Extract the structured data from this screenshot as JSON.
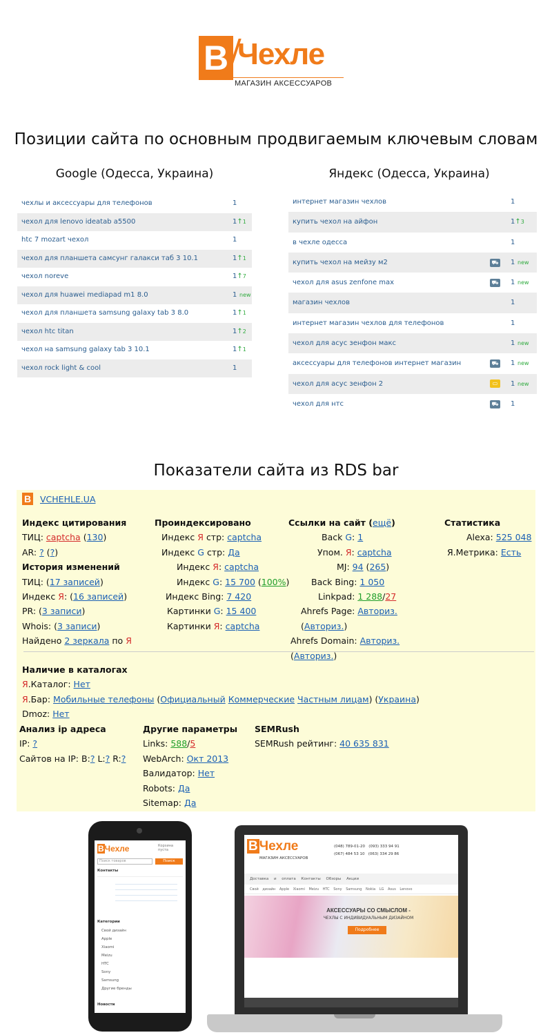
{
  "logo": {
    "letter": "B",
    "name": "Чехле",
    "subtitle": "МАГАЗИН АКСЕССУАРОВ",
    "brand_color": "#f07b1a"
  },
  "title_positions": "Позиции сайта по основным продвигаемым ключевым словам",
  "google": {
    "title": "Google (Одесса, Украина)",
    "rows": [
      {
        "kw": "чехлы и аксессуары для телефонов",
        "pos": "1",
        "arrow": "",
        "change": ""
      },
      {
        "kw": "чехол для lenovo ideatab a5500",
        "pos": "1",
        "arrow": "↑",
        "change": "1"
      },
      {
        "kw": "htc 7 mozart чехол",
        "pos": "1",
        "arrow": "",
        "change": ""
      },
      {
        "kw": "чехол для планшета самсунг галакси таб 3 10.1",
        "pos": "1",
        "arrow": "↑",
        "change": "1"
      },
      {
        "kw": "чехол noreve",
        "pos": "1",
        "arrow": "↑",
        "change": "7"
      },
      {
        "kw": "чехол для huawei mediapad m1 8.0",
        "pos": "1",
        "arrow": "",
        "change": "new"
      },
      {
        "kw": "чехол для планшета samsung galaxy tab 3 8.0",
        "pos": "1",
        "arrow": "↑",
        "change": "1"
      },
      {
        "kw": "чехол htc titan",
        "pos": "1",
        "arrow": "↑",
        "change": "2"
      },
      {
        "kw": "чехол на samsung galaxy tab 3 10.1",
        "pos": "1",
        "arrow": "↑",
        "change": "1"
      },
      {
        "kw": "чехол rock light & cool",
        "pos": "1",
        "arrow": "",
        "change": ""
      }
    ]
  },
  "yandex": {
    "title": "Яндекс (Одесса, Украина)",
    "rows": [
      {
        "kw": "интернет магазин чехлов",
        "pos": "1",
        "arrow": "",
        "change": "",
        "icon": ""
      },
      {
        "kw": "купить чехол на айфон",
        "pos": "1",
        "arrow": "↑",
        "change": "3",
        "icon": ""
      },
      {
        "kw": "в чехле одесса",
        "pos": "1",
        "arrow": "",
        "change": "",
        "icon": ""
      },
      {
        "kw": "купить чехол на мейзу м2",
        "pos": "1",
        "arrow": "",
        "change": "new",
        "icon": "cart-icon"
      },
      {
        "kw": "чехол для asus zenfone max",
        "pos": "1",
        "arrow": "",
        "change": "new",
        "icon": "cart-icon"
      },
      {
        "kw": "магазин чехлов",
        "pos": "1",
        "arrow": "",
        "change": "",
        "icon": ""
      },
      {
        "kw": "интернет магазин чехлов для телефонов",
        "pos": "1",
        "arrow": "",
        "change": "",
        "icon": ""
      },
      {
        "kw": "чехол для асус зенфон макс",
        "pos": "1",
        "arrow": "",
        "change": "new",
        "icon": ""
      },
      {
        "kw": "аксессуары для телефонов интернет магазин",
        "pos": "1",
        "arrow": "",
        "change": "new",
        "icon": "cart-icon"
      },
      {
        "kw": "чехол для асус зенфон 2",
        "pos": "1",
        "arrow": "",
        "change": "new",
        "icon": "folder-icon"
      },
      {
        "kw": "чехол для нтс",
        "pos": "1",
        "arrow": "",
        "change": "",
        "icon": "cart-icon"
      }
    ]
  },
  "title_rds": "Показатели сайта из RDS bar",
  "rds": {
    "site": "VCHEHLE.UA",
    "col1_title": "Индекс цитирования",
    "tic_label": "ТИЦ:",
    "tic_val": "captcha",
    "tic_num": "130",
    "ar_label": "AR:",
    "ar_q1": "?",
    "ar_q2": "?",
    "history_title": "История изменений",
    "h_tic_label": "ТИЦ:",
    "h_tic_link": "17 записей",
    "h_ya_label_a": "Индекс",
    "h_ya_label_b": "Я",
    "h_ya_link": "16 записей",
    "pr_label": "PR:",
    "pr_link": "3 записи",
    "whois_label": "Whois:",
    "whois_link": "3 записи",
    "mirrors_a": "Найдено",
    "mirrors_link": "2 зеркала",
    "mirrors_b": "по",
    "mirrors_ya": "Я",
    "col2_title": "Проиндексировано",
    "idx_ya_str_a": "Индекс",
    "idx_ya_str_b": "Я",
    "idx_ya_str_c": "стр:",
    "idx_ya_str_v": "captcha",
    "idx_g_str_a": "Индекс",
    "idx_g_str_b": "G",
    "idx_g_str_c": "стр:",
    "idx_g_str_v": "Да",
    "idx_ya_a": "Индекс",
    "idx_ya_b": "Я",
    "idx_ya_c": ":",
    "idx_ya_v": "captcha",
    "idx_g_a": "Индекс",
    "idx_g_b": "G",
    "idx_g_c": ":",
    "idx_g_v": "15 700",
    "idx_g_p": "100%",
    "idx_bing_label": "Индекс Bing:",
    "idx_bing_v": "7 420",
    "img_g_a": "Картинки",
    "img_g_b": "G",
    "img_g_c": ":",
    "img_g_v": "15 400",
    "img_ya_a": "Картинки",
    "img_ya_b": "Я",
    "img_ya_c": ":",
    "img_ya_v": "captcha",
    "col3_title": "Ссылки на сайт",
    "col3_link": "ещё",
    "back_g_a": "Back",
    "back_g_b": "G",
    "back_g_c": ":",
    "back_g_v": "1",
    "upom_a": "Упом.",
    "upom_b": "Я",
    "upom_c": ":",
    "upom_v": "captcha",
    "mj_label": "MJ:",
    "mj_v": "94",
    "mj_p": "265",
    "back_bing_label": "Back Bing:",
    "back_bing_v": "1 050",
    "linkpad_label": "Linkpad:",
    "linkpad_v1": "1 288",
    "linkpad_v2": "27",
    "ah_page_label": "Ahrefs Page:",
    "ah_page_v": "Авториз.",
    "ah_page_p": "Авториз.",
    "ah_dom_label": "Ahrefs Domain:",
    "ah_dom_v": "Авториз.",
    "ah_dom_p": "Авториз.",
    "col4_title": "Статистика",
    "alexa_label": "Alexa:",
    "alexa_v": "525 048",
    "metrika_label": "Я.Метрика:",
    "metrika_v": "Есть",
    "cat_title": "Наличие в каталогах",
    "cat_ya_a": "Я",
    "cat_ya_b": ".Каталог:",
    "cat_ya_v": "Нет",
    "bar_a": "Я",
    "bar_b": ".Бар:",
    "bar_l1": "Мобильные телефоны",
    "bar_l2": "Официальный",
    "bar_l3": "Коммерческие",
    "bar_l4": "Частным лицам",
    "bar_l5": "Украина",
    "dmoz_label": "Dmoz:",
    "dmoz_v": "Нет",
    "ip_title": "Анализ ip адреса",
    "ip_label": "IP:",
    "ip_v": "?",
    "ipsites_label": "Сайтов на IP:",
    "ipsites_b": "B:",
    "ipsites_bv": "?",
    "ipsites_l": "L:",
    "ipsites_lv": "?",
    "ipsites_r": "R:",
    "ipsites_rv": "?",
    "other_title": "Другие параметры",
    "links_label": "Links:",
    "links_v1": "588",
    "links_v2": "5",
    "webarch_label": "WebArch:",
    "webarch_v": "Окт 2013",
    "valid_label": "Валидатор:",
    "valid_v": "Нет",
    "robots_label": "Robots:",
    "robots_v": "Да",
    "sitemap_label": "Sitemap:",
    "sitemap_v": "Да",
    "sem_title": "SEMRush",
    "sem_label": "SEMRush рейтинг:",
    "sem_v": "40 635 831"
  },
  "phone": {
    "logo": "Чехле",
    "cart": "Корзина пуста",
    "search_ph": "Поиск товаров",
    "search_btn": "Поиск",
    "contacts": "Контакты",
    "categories": "Категории",
    "cat_items": [
      "Свой дизайн",
      "Apple",
      "Xiaomi",
      "Meizu",
      "HTC",
      "Sony",
      "Samsung",
      "Другие бренды"
    ],
    "news": "Новости"
  },
  "laptop": {
    "logo": "Чехле",
    "tag": "МАГАЗИН АКСЕССУАРОВ",
    "phones": [
      "(048) 789-01-20",
      "(093) 333 94 91",
      "(067) 484 53 10",
      "(063) 334 29 86"
    ],
    "nav": "Доставка и оплата  Контакты  Обзоры  Акции",
    "brands": "Свой дизайн  Apple  Xiaomi  Meizu  HTC  Sony  Samsung  Nokia  LG  Asus  Lenovo",
    "banner_title": "АКСЕССУАРЫ СО СМЫСЛОМ -",
    "banner_sub": "ЧЕХЛЫ С ИНДИВИДУАЛЬНЫМ ДИЗАЙНОМ",
    "banner_btn": "Подробнее"
  }
}
